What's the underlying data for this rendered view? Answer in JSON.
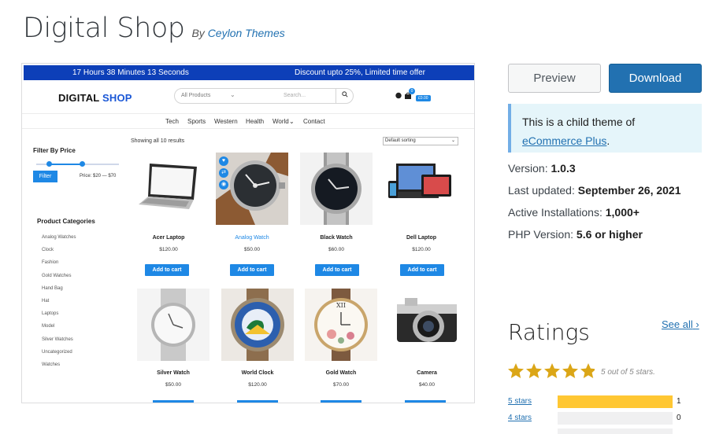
{
  "theme": {
    "title": "Digital Shop",
    "by_prefix": "By",
    "author": "Ceylon Themes"
  },
  "screenshot": {
    "topbar": {
      "countdown": "17 Hours 38 Minutes 13 Seconds",
      "offer": "Discount upto 25%, Limited time offer"
    },
    "logo": {
      "part1": "DIGITAL",
      "part2": "SHOP"
    },
    "search": {
      "category": "All Products",
      "placeholder": "Search...",
      "button_icon": "search-icon"
    },
    "cart": {
      "count": "0",
      "price": "£0.00"
    },
    "nav": [
      "Tech",
      "Sports",
      "Western",
      "Health",
      "World",
      "Contact"
    ],
    "filter": {
      "title": "Filter By Price",
      "button": "Filter",
      "price_range": "Price: $20 — $70"
    },
    "categories": {
      "title": "Product Categories",
      "items": [
        "Analog Watches",
        "Clock",
        "Fashion",
        "Gold Watches",
        "Hand Bag",
        "Hat",
        "Laptops",
        "Model",
        "Silver Watches",
        "Uncategorized",
        "Watches"
      ]
    },
    "results_text": "Showing all 10 results",
    "sorting": "Default sorting",
    "add_to_cart": "Add to cart",
    "products": [
      {
        "name": "Acer Laptop",
        "price": "$120.00"
      },
      {
        "name": "Analog Watch",
        "price": "$50.00"
      },
      {
        "name": "Black Watch",
        "price": "$60.00"
      },
      {
        "name": "Dell Laptop",
        "price": "$120.00"
      },
      {
        "name": "Silver Watch",
        "price": "$50.00"
      },
      {
        "name": "World Clock",
        "price": "$120.00"
      },
      {
        "name": "Gold Watch",
        "price": "$70.00"
      },
      {
        "name": "Camera",
        "price": "$40.00"
      }
    ]
  },
  "actions": {
    "preview": "Preview",
    "download": "Download"
  },
  "notice": {
    "text": "This is a child theme of",
    "link": "eCommerce Plus",
    "suffix": "."
  },
  "meta": {
    "version_label": "Version:",
    "version": "1.0.3",
    "updated_label": "Last updated:",
    "updated": "September 26, 2021",
    "installs_label": "Active Installations:",
    "installs": "1,000+",
    "php_label": "PHP Version:",
    "php": "5.6 or higher"
  },
  "ratings": {
    "title": "Ratings",
    "see_all": "See all",
    "stars_label": "5 out of 5 stars.",
    "stars_value": 5,
    "rows": [
      {
        "label": "5 stars",
        "count": "1",
        "fraction": 1.0
      },
      {
        "label": "4 stars",
        "count": "0",
        "fraction": 0
      }
    ]
  },
  "colors": {
    "accent": "#2271b1",
    "shop_blue": "#1e88e5",
    "topbar": "#0d3fb8",
    "star": "#dba617",
    "bar": "#ffc733"
  }
}
